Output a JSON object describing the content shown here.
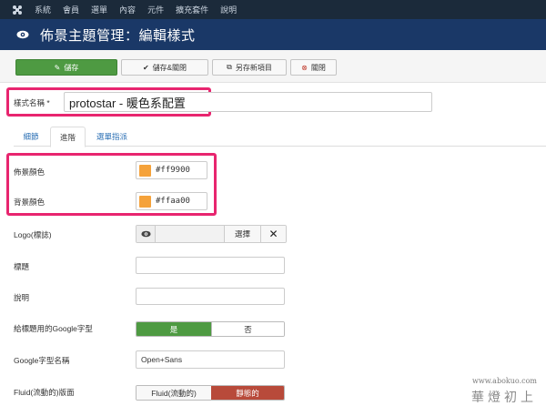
{
  "topnav": {
    "menu": [
      "系統",
      "會員",
      "選單",
      "內容",
      "元件",
      "擴充套件",
      "說明"
    ]
  },
  "header": {
    "title": "佈景主題管理：編輯樣式"
  },
  "toolbar": {
    "save": "儲存",
    "save_close": "儲存&關閉",
    "save_copy": "另存新項目",
    "close": "關閉"
  },
  "style_name": {
    "label": "樣式名稱 *",
    "value": "protostar - 暖色系配置"
  },
  "tabs": [
    "細節",
    "進階",
    "選單指派"
  ],
  "template_color": {
    "label": "佈景顏色",
    "value": "#ff9900"
  },
  "background_color": {
    "label": "背景顏色",
    "value": "#ffaa00"
  },
  "logo": {
    "label": "Logo(標誌)",
    "select_button": "選擇"
  },
  "title_field": {
    "label": "標題"
  },
  "description": {
    "label": "說明"
  },
  "google_font_toggle": {
    "label": "給標題用的Google字型",
    "yes": "是",
    "no": "否"
  },
  "google_font_name": {
    "label": "Google字型名稱",
    "value": "Open+Sans"
  },
  "fluid_layout": {
    "label": "Fluid(流動的)版面",
    "fluid": "Fluid(流動的)",
    "static": "靜態的"
  },
  "watermark": {
    "url": "www.abokuo.com",
    "name": "華燈初上"
  },
  "colors": {
    "accent": "#e8256f",
    "swatch": "#f5a23a",
    "green": "#4e9a42",
    "red": "#b84a3a",
    "header": "#1a3867",
    "nav": "#1b2a3a"
  }
}
